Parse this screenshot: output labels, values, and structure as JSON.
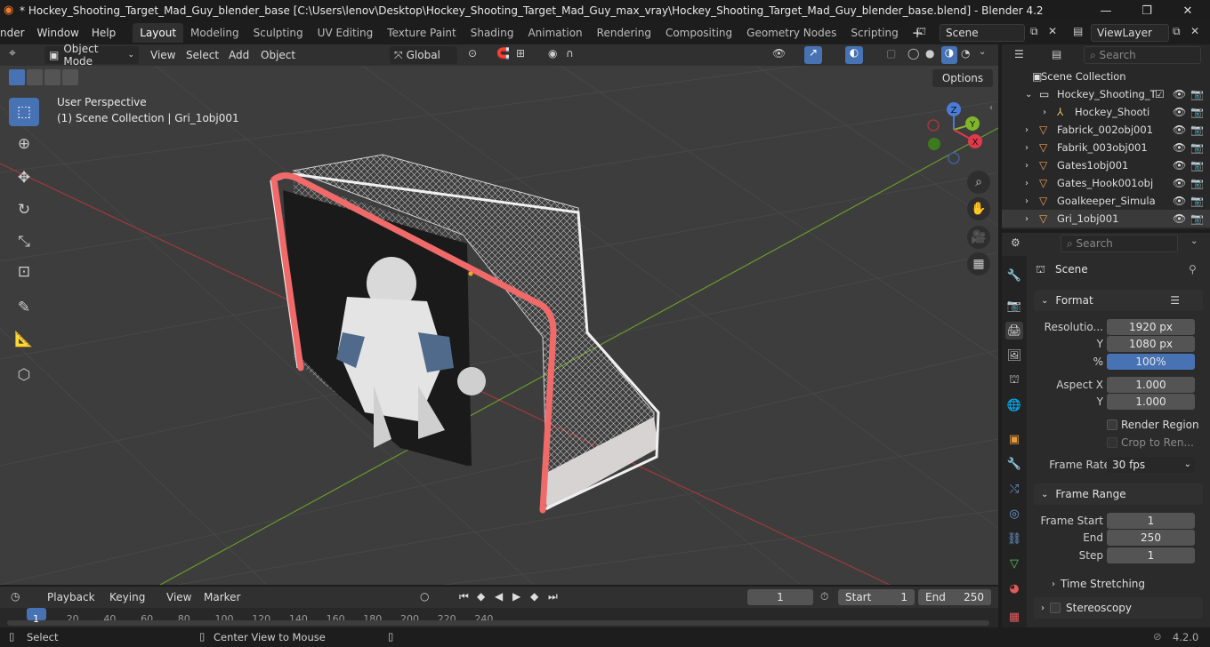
{
  "window": {
    "title": "* Hockey_Shooting_Target_Mad_Guy_blender_base [C:\\Users\\lenov\\Desktop\\Hockey_Shooting_Target_Mad_Guy_max_vray\\Hockey_Shooting_Target_Mad_Guy_blender_base.blend] - Blender 4.2",
    "minimize": "—",
    "maximize": "❐",
    "close": "✕"
  },
  "menu": {
    "items": [
      "nder",
      "Window",
      "Help"
    ]
  },
  "workspaces": [
    "Layout",
    "Modeling",
    "Sculpting",
    "UV Editing",
    "Texture Paint",
    "Shading",
    "Animation",
    "Rendering",
    "Compositing",
    "Geometry Nodes",
    "Scripting"
  ],
  "scene_field": "Scene",
  "viewlayer_field": "ViewLayer",
  "header3d": {
    "mode": "Object Mode",
    "view": "View",
    "select": "Select",
    "add": "Add",
    "object": "Object",
    "transform": "Global",
    "options": "Options"
  },
  "viewport": {
    "perspective": "User Perspective",
    "collection": "(1) Scene Collection | Gri_1obj001"
  },
  "outliner": {
    "search_placeholder": "Search",
    "root": "Scene Collection",
    "items": [
      {
        "name": "Hockey_Shooting_T",
        "indent": 1,
        "icon": "collection-icon"
      },
      {
        "name": "Hockey_Shooti",
        "indent": 2,
        "icon": "armature-icon"
      },
      {
        "name": "Fabrick_002obj001",
        "indent": 1,
        "icon": "mesh-icon"
      },
      {
        "name": "Fabrik_003obj001",
        "indent": 1,
        "icon": "mesh-icon"
      },
      {
        "name": "Gates1obj001",
        "indent": 1,
        "icon": "mesh-icon"
      },
      {
        "name": "Gates_Hook001obj",
        "indent": 1,
        "icon": "mesh-icon"
      },
      {
        "name": "Goalkeeper_Simula",
        "indent": 1,
        "icon": "mesh-icon"
      },
      {
        "name": "Gri_1obj001",
        "indent": 1,
        "icon": "mesh-icon"
      }
    ]
  },
  "properties": {
    "search_placeholder": "Search",
    "context": "Scene",
    "format": {
      "header": "Format",
      "res_label": "Resolutio...",
      "res_x": "1920 px",
      "y_label": "Y",
      "res_y": "1080 px",
      "pct_label": "%",
      "pct": "100%",
      "aspx_label": "Aspect X",
      "aspx": "1.000",
      "aspy_label": "Y",
      "aspy": "1.000",
      "render_region": "Render Region",
      "crop": "Crop to Ren...",
      "fr_label": "Frame Rate",
      "fr": "30 fps"
    },
    "frame_range": {
      "header": "Frame Range",
      "start_label": "Frame Start",
      "start": "1",
      "end_label": "End",
      "end": "250",
      "step_label": "Step",
      "step": "1"
    },
    "time_stretching": "Time Stretching",
    "stereoscopy": "Stereoscopy"
  },
  "timeline": {
    "playback": "Playback",
    "keying": "Keying",
    "view": "View",
    "marker": "Marker",
    "current": "1",
    "start_label": "Start",
    "start": "1",
    "end_label": "End",
    "end": "250",
    "ticks": [
      "1",
      "20",
      "40",
      "60",
      "80",
      "100",
      "120",
      "140",
      "160",
      "180",
      "200",
      "220",
      "240"
    ]
  },
  "status": {
    "select": "Select",
    "center": "Center View to Mouse",
    "version": "4.2.0"
  }
}
